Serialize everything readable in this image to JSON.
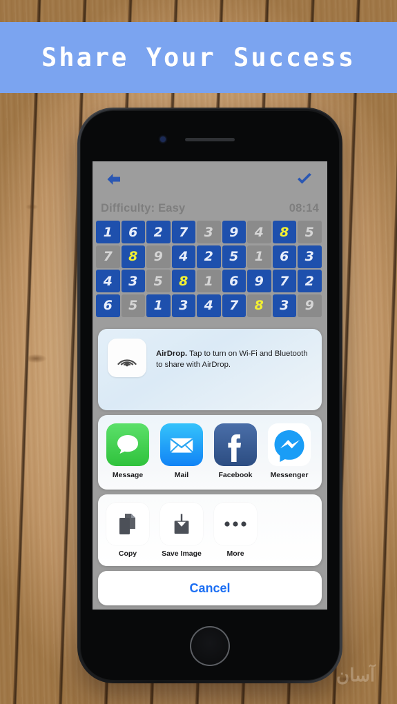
{
  "banner": {
    "title": "Share Your Success",
    "background": "#7ba4f0",
    "text_color": "#ffffff"
  },
  "background": {
    "kind": "wood-planks",
    "color": "#d9b487"
  },
  "phone": {
    "camera": "camera-dot",
    "speaker": "speaker-grille",
    "home_button": "home-button"
  },
  "game": {
    "back_icon": "back-arrow-icon",
    "done_icon": "checkmark-icon",
    "accent": "#2255b4",
    "difficulty_label": "Difficulty: Easy",
    "timer": "08:14",
    "grid": {
      "rows": [
        [
          {
            "v": "1",
            "s": "user"
          },
          {
            "v": "6",
            "s": "user"
          },
          {
            "v": "2",
            "s": "user"
          },
          {
            "v": "7",
            "s": "user"
          },
          {
            "v": "3",
            "s": "fixed"
          },
          {
            "v": "9",
            "s": "user"
          },
          {
            "v": "4",
            "s": "fixed"
          },
          {
            "v": "8",
            "s": "hl"
          },
          {
            "v": "5",
            "s": "fixed"
          }
        ],
        [
          {
            "v": "7",
            "s": "fixed"
          },
          {
            "v": "8",
            "s": "hl"
          },
          {
            "v": "9",
            "s": "fixed"
          },
          {
            "v": "4",
            "s": "user"
          },
          {
            "v": "2",
            "s": "user"
          },
          {
            "v": "5",
            "s": "user"
          },
          {
            "v": "1",
            "s": "fixed"
          },
          {
            "v": "6",
            "s": "user"
          },
          {
            "v": "3",
            "s": "user"
          }
        ],
        [
          {
            "v": "4",
            "s": "user"
          },
          {
            "v": "3",
            "s": "user"
          },
          {
            "v": "5",
            "s": "fixed"
          },
          {
            "v": "8",
            "s": "hl"
          },
          {
            "v": "1",
            "s": "fixed"
          },
          {
            "v": "6",
            "s": "user"
          },
          {
            "v": "9",
            "s": "user"
          },
          {
            "v": "7",
            "s": "user"
          },
          {
            "v": "2",
            "s": "user"
          }
        ],
        [
          {
            "v": "6",
            "s": "user"
          },
          {
            "v": "5",
            "s": "fixed"
          },
          {
            "v": "1",
            "s": "user"
          },
          {
            "v": "3",
            "s": "user"
          },
          {
            "v": "4",
            "s": "user"
          },
          {
            "v": "7",
            "s": "user"
          },
          {
            "v": "8",
            "s": "hlg"
          },
          {
            "v": "3",
            "s": "user"
          },
          {
            "v": "9",
            "s": "fixed"
          }
        ]
      ]
    }
  },
  "share_sheet": {
    "airdrop": {
      "icon": "airdrop-icon",
      "title": "AirDrop.",
      "description": " Tap to turn on Wi-Fi and Bluetooth to share with AirDrop."
    },
    "apps": [
      {
        "label": "Message",
        "icon": "messages-icon"
      },
      {
        "label": "Mail",
        "icon": "mail-icon"
      },
      {
        "label": "Facebook",
        "icon": "facebook-icon"
      },
      {
        "label": "Messenger",
        "icon": "messenger-icon"
      },
      {
        "label": "",
        "icon": "twitter-icon"
      }
    ],
    "actions": [
      {
        "label": "Copy",
        "icon": "copy-icon"
      },
      {
        "label": "Save Image",
        "icon": "save-image-icon"
      },
      {
        "label": "More",
        "icon": "more-dots-icon"
      }
    ],
    "cancel_label": "Cancel",
    "cancel_color": "#1b6ef3"
  },
  "watermark": {
    "text": "آسان"
  }
}
